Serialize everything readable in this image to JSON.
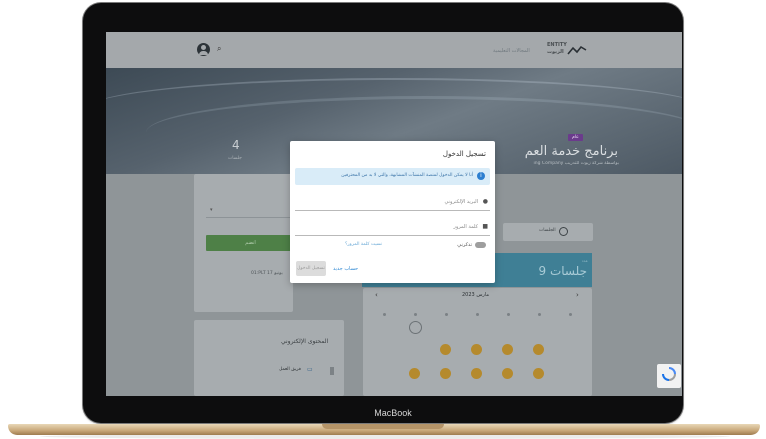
{
  "device": {
    "brand_label": "MacBook"
  },
  "header": {
    "logo_text": "ENTITY",
    "logo_sub": "الزيوت",
    "nav_link": "المجالات التعليمية"
  },
  "hero": {
    "badge": "عام",
    "title": "برنامج خدمة العم",
    "subtitle": "ing Company بواسطة شركة زيوت للتدريب",
    "stat_value": "4",
    "stat_label": "جلسات"
  },
  "side_card": {
    "select_value": "",
    "button_label": "انضم",
    "date_text": "01:PLT 17 يونيو"
  },
  "content_card": {
    "title": "المحتوى الإلكتروني",
    "item_label": "فريق العمل"
  },
  "sessions": {
    "tab_label": "الجلسات",
    "banner_sub": "عدد",
    "banner_title": "9 جلسات"
  },
  "calendar": {
    "month": "مارس 2023",
    "prev": "‹",
    "next": "›",
    "orange_color": "#b58a2d"
  },
  "modal": {
    "title": "تسجيل الدخول",
    "info_text": "أنا لا يمكن الدخول لمنصة المنشآت المشابهة، والتي لا بد من المحترفين",
    "email_placeholder": "البريد الإلكتروني",
    "password_placeholder": "كلمة المرور",
    "remember_label": "تذكرني",
    "forgot_link": "نسيت كلمة المرور؟",
    "login_button": "تسجيل الدخول",
    "register_link": "حساب جديد"
  }
}
